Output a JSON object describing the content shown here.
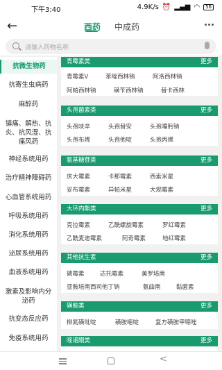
{
  "status": {
    "time": "下午3:40",
    "speed": "4.9K/s",
    "battery": "56"
  },
  "header": {
    "back": "←",
    "tabs": [
      "西药",
      "中成药"
    ]
  },
  "search": {
    "placeholder": "请输入药物名称"
  },
  "sidebar": {
    "items": [
      "抗微生物药",
      "抗寄生虫病药",
      "麻醉药",
      "镇痛、解热、抗炎、抗风湿、抗痛风药",
      "神经系统用药",
      "治疗精神障碍药",
      "心血管系统用药",
      "呼吸系统用药",
      "消化系统用药",
      "泌尿系统用药",
      "血液系统用药",
      "激素及影响内分泌药",
      "抗变态反应药",
      "免疫系统用药"
    ]
  },
  "categories": [
    {
      "title": "青霉素类",
      "more": "更多",
      "drugs": [
        "青霉素V",
        "苯唑西林钠",
        "阿洛西林钠",
        "阿帕西林钠",
        "磺苄西林钠",
        "替卡西林"
      ]
    },
    {
      "title": "头孢菌素类",
      "more": "更多",
      "drugs": [
        "头孢呋辛",
        "头孢替安",
        "头孢噻肟钠",
        "头孢布烯",
        "头孢他啶",
        "头孢丙烯"
      ]
    },
    {
      "title": "氨基糖苷类",
      "more": "更多",
      "drugs": [
        "庆大霉素",
        "卡那霉素",
        "西索米星",
        "妥布霉素",
        "异帕米星",
        "大观霉素"
      ]
    },
    {
      "title": "大环内酯类",
      "more": "更多",
      "drugs": [
        "克拉霉素",
        "乙酰螺旋霉素",
        "罗红霉素",
        "乙酰麦迪霉素",
        "阿奇霉素",
        "地红霉素"
      ]
    },
    {
      "title": "其他抗生素",
      "more": "更多",
      "drugs": [
        "磷霉素",
        "达托霉素",
        "美罗培南",
        "亚胺培南西司他丁钠",
        "氨曲南",
        "黏菌素"
      ]
    },
    {
      "title": "磺胺类",
      "more": "更多",
      "drugs": [
        "柳氮磺吡啶",
        "磺胺嘧啶",
        "复方磺胺甲噁唑"
      ]
    },
    {
      "title": "喹诺酮类",
      "more": "更多",
      "drugs": []
    }
  ],
  "nav": {
    "back": "<"
  }
}
